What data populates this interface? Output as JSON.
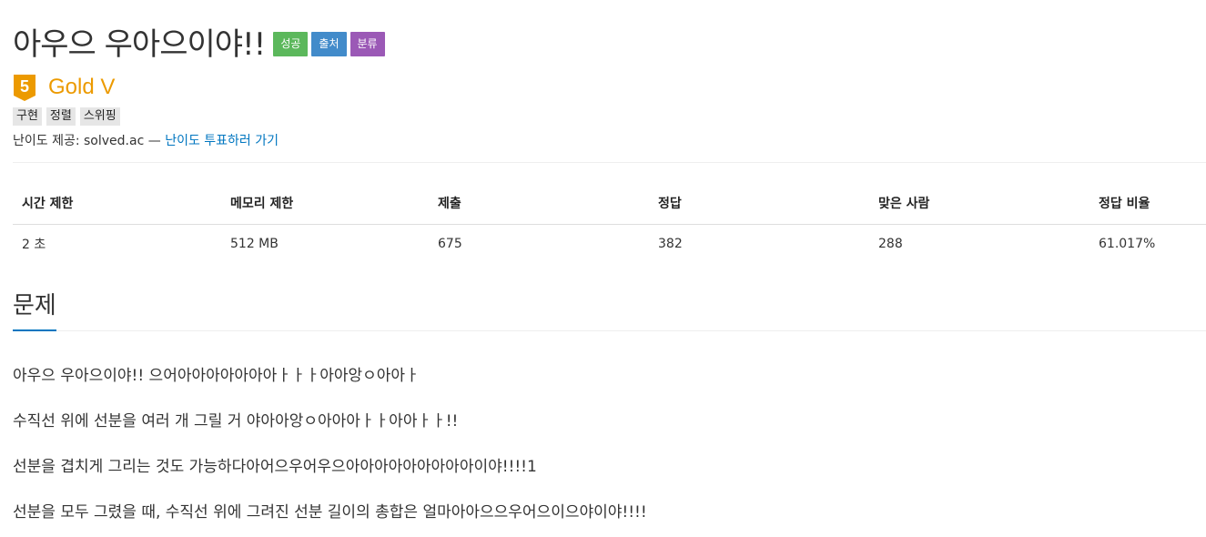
{
  "problem": {
    "title": "아우으 우아으이야!!",
    "labels": [
      {
        "text": "성공",
        "color": "#5cb85c"
      },
      {
        "text": "출처",
        "color": "#428bca"
      },
      {
        "text": "분류",
        "color": "#9b59b6"
      }
    ]
  },
  "tier": {
    "badge_number": "5",
    "badge_color": "#ec9a00",
    "name": "Gold V"
  },
  "tags": [
    "구현",
    "정렬",
    "스위핑"
  ],
  "credit": {
    "prefix": "난이도 제공: solved.ac — ",
    "vote_link": "난이도 투표하러 가기"
  },
  "stats": {
    "headers": [
      "시간 제한",
      "메모리 제한",
      "제출",
      "정답",
      "맞은 사람",
      "정답 비율"
    ],
    "values": [
      "2 초",
      "512 MB",
      "675",
      "382",
      "288",
      "61.017%"
    ]
  },
  "section": {
    "title": "문제"
  },
  "description": [
    "아우으 우아으이야!! 으어아아아아아아아ㅏㅏㅏ아아앙ㅇ아아ㅏ",
    "수직선 위에 선분을 여러 개 그릴 거 야아아앙ㅇ아아아ㅏㅏ아아ㅏㅏ!!",
    "선분을 겹치게 그리는 것도 가능하다아어으우어우으아아아아아아아아아이야!!!!1",
    "선분을 모두 그렸을 때, 수직선 위에 그려진 선분 길이의 총합은 얼마아아으으우어으이으야이야!!!!"
  ],
  "colors": {
    "accent": "#0076c0",
    "tier": "#ec9a00"
  }
}
